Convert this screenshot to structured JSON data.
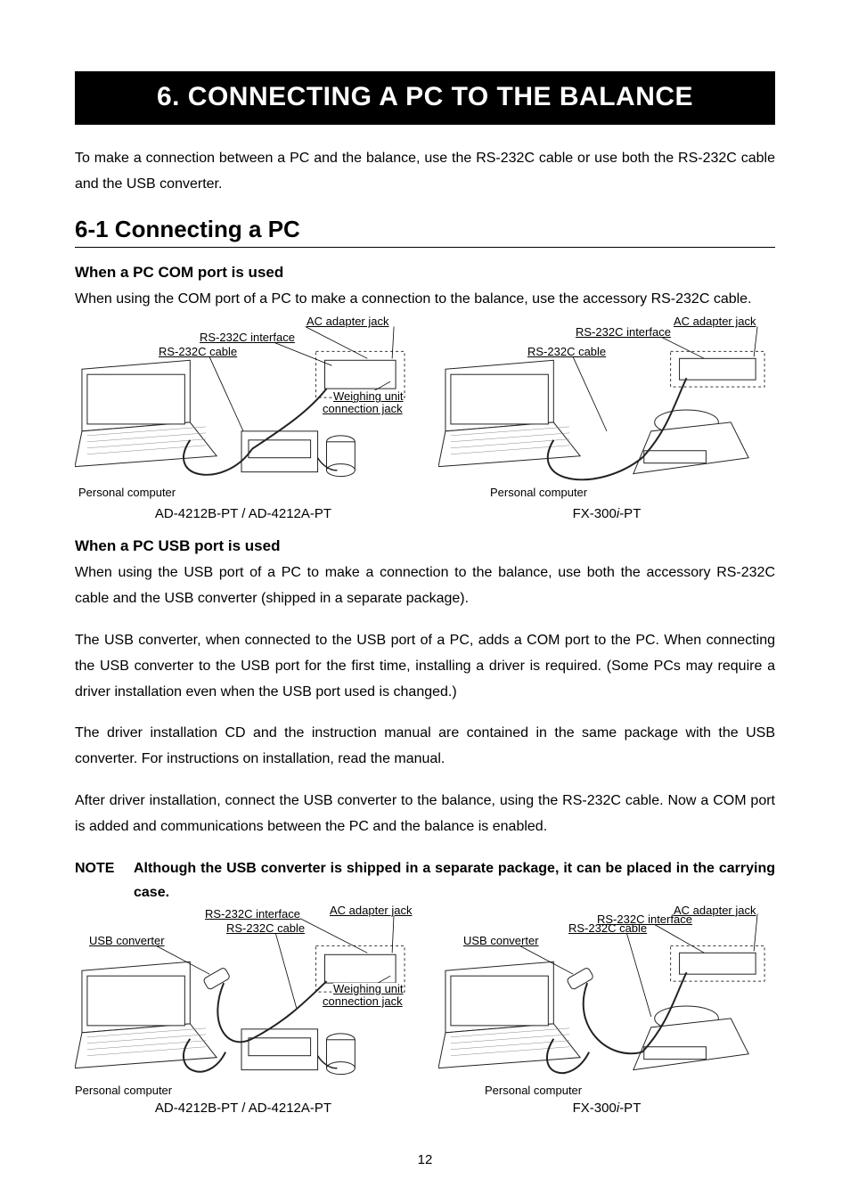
{
  "chapter_title": "6.  CONNECTING A PC TO THE BALANCE",
  "intro": "To make a connection between a PC and the balance, use the RS-232C cable or use both the RS-232C cable and the USB converter.",
  "section_heading": "6-1  Connecting a PC",
  "sub1": {
    "heading": "When a PC COM port is used",
    "body": "When using the COM port of a PC to make a connection to the balance, use the accessory RS-232C cable.",
    "labels": {
      "rs_cable": "RS-232C cable",
      "rs_if": "RS-232C interface",
      "ac_jack": "AC adapter jack",
      "weigh_jack_l1": "Weighing unit",
      "weigh_jack_l2": "connection jack",
      "pc": "Personal computer"
    },
    "caption_left_prefix": "AD-4212B-PT / AD-4212A-PT",
    "caption_right_prefix": "FX-300",
    "caption_right_italic": "i",
    "caption_right_suffix": "-PT"
  },
  "sub2": {
    "heading": "When a PC USB port is used",
    "p1": "When using the USB port of a PC to make a connection to the balance, use both the accessory RS-232C cable and the USB converter (shipped in a separate package).",
    "p2": "The USB converter, when connected to the USB port of a PC, adds a COM port to the PC. When connecting the USB converter to the USB port for the first time, installing a driver is required. (Some PCs may require a driver installation even when the USB port used is changed.)",
    "p3": "The driver installation CD and the instruction manual are contained in the same package with the USB converter. For instructions on installation, read the manual.",
    "p4": "After driver installation, connect the USB converter to the balance, using the RS-232C cable. Now a COM port is added and communications between the PC and the balance is enabled.",
    "note_label": "NOTE",
    "note_text": "Although the USB converter is shipped in a separate package, it can be placed in the carrying case.",
    "labels": {
      "usb_conv": "USB converter",
      "rs_cable": "RS-232C cable",
      "rs_if": "RS-232C interface",
      "ac_jack": "AC adapter jack",
      "weigh_jack_l1": "Weighing unit",
      "weigh_jack_l2": "connection jack",
      "pc": "Personal computer"
    },
    "caption_left_prefix": "AD-4212B-PT / AD-4212A-PT",
    "caption_right_prefix": "FX-300",
    "caption_right_italic": "i",
    "caption_right_suffix": "-PT"
  },
  "page_number": "12"
}
